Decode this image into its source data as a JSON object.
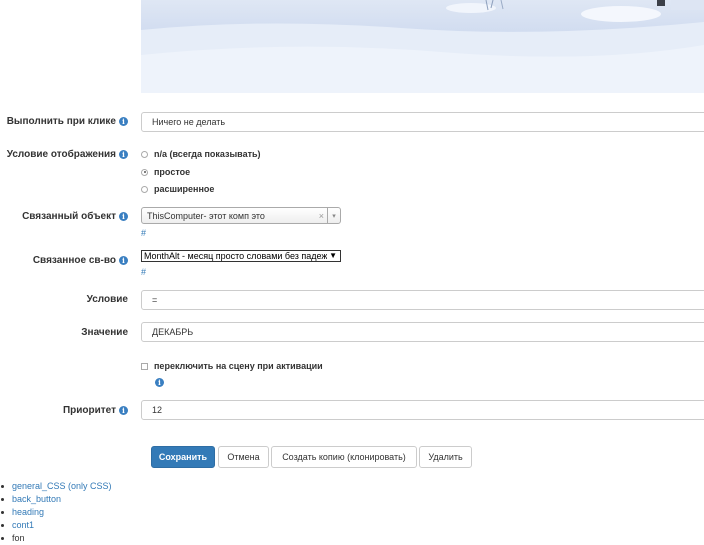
{
  "form": {
    "on_click": {
      "label": "Выполнить при клике",
      "value": "Ничего не делать"
    },
    "display_condition": {
      "label": "Условие отображения",
      "options": [
        "n/a (всегда показывать)",
        "простое",
        "расширенное"
      ],
      "selected": "простое"
    },
    "linked_object": {
      "label": "Связанный объект",
      "value": "ThisComputer- этот комп это",
      "link": "#"
    },
    "linked_property": {
      "label": "Связанное св-во",
      "value": "MonthAlt - месяц просто словами без падежа",
      "link": "#"
    },
    "condition": {
      "label": "Условие",
      "value": "="
    },
    "value": {
      "label": "Значение",
      "value": "ДЕКАБРЬ"
    },
    "switch_scene": {
      "label": "переключить на сцену при активации",
      "checked": false
    },
    "priority": {
      "label": "Приоритет",
      "value": "12"
    }
  },
  "buttons": {
    "save": "Сохранить",
    "cancel": "Отмена",
    "clone": "Создать копию (клонировать)",
    "delete": "Удалить"
  },
  "links": [
    "general_CSS (only CSS)",
    "back_button",
    "heading",
    "cont1",
    "fon"
  ],
  "icons": {
    "info": "i",
    "clear": "×",
    "arrow": "▾",
    "select_arrow": "▼"
  },
  "colors": {
    "primary": "#337ab7",
    "info_icon": "#3a7fc1",
    "link": "#337ab7"
  }
}
